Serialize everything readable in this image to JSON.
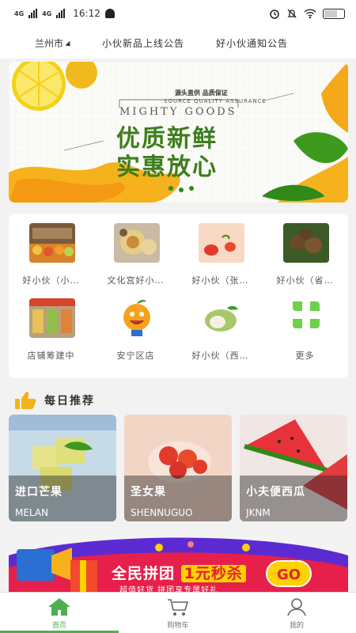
{
  "status_bar": {
    "signal1_label": "4G",
    "signal2_label": "4G",
    "time": "16:12",
    "battery_text": ""
  },
  "notice_bar": {
    "city": "兰州市",
    "notices": [
      "小伙新品上线公告",
      "好小伙通知公告"
    ]
  },
  "banner": {
    "tagline": "源头直供 品质保证",
    "tagline_en": "SOURCE QUALITY ASSURANCE",
    "brand_en": "MIGHTY GOODS",
    "line1": "优质新鲜",
    "line2": "实惠放心"
  },
  "categories": [
    {
      "label": "好小伙（小…",
      "icon": "fruit-shop-photo"
    },
    {
      "label": "文化宫好小…",
      "icon": "tea-fruit-photo"
    },
    {
      "label": "好小伙（张…",
      "icon": "tomato-photo"
    },
    {
      "label": "好小伙（省…",
      "icon": "kiwi-photo"
    },
    {
      "label": "店铺筹建中",
      "icon": "store-interior-photo"
    },
    {
      "label": "安宁区店",
      "icon": "orange-mascot-icon"
    },
    {
      "label": "好小伙（西…",
      "icon": "custard-apple-photo"
    },
    {
      "label": "更多",
      "icon": "clover-more-icon"
    }
  ],
  "daily": {
    "title": "每日推荐",
    "items": [
      {
        "name": "进口芒果",
        "en": "MELAN"
      },
      {
        "name": "圣女果",
        "en": "SHENNUGUO"
      },
      {
        "name": "小夫便西瓜",
        "en": "JKNM"
      }
    ]
  },
  "promo": {
    "title_prefix": "全民拼团",
    "title_highlight": "1元秒杀",
    "subtitle": "超值好货 拼团享专属好礼",
    "go_label": "GO"
  },
  "tabs": [
    {
      "label": "首页",
      "icon": "home-icon",
      "active": true
    },
    {
      "label": "购物车",
      "icon": "cart-icon",
      "active": false
    },
    {
      "label": "我的",
      "icon": "user-icon",
      "active": false
    }
  ],
  "colors": {
    "accent": "#4caf50",
    "banner_green": "#3e7d1d",
    "promo_red": "#e2202e",
    "promo_yellow": "#ffd200"
  }
}
